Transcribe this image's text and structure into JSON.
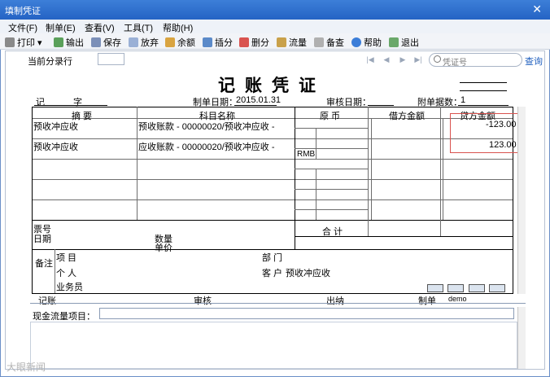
{
  "window": {
    "title": "填制凭证",
    "close_glyph": "✕"
  },
  "menu": [
    "文件(F)",
    "制单(E)",
    "查看(V)",
    "工具(T)",
    "帮助(H)"
  ],
  "toolbar": [
    {
      "label": "打印",
      "icon": "printer-icon"
    },
    {
      "label": "输出",
      "icon": "export-icon"
    },
    {
      "label": "保存",
      "icon": "save-icon"
    },
    {
      "label": "放弃",
      "icon": "discard-icon"
    },
    {
      "label": "余额",
      "icon": "balance-icon"
    },
    {
      "label": "插分",
      "icon": "insert-row-icon"
    },
    {
      "label": "删分",
      "icon": "delete-row-icon"
    },
    {
      "label": "流量",
      "icon": "cashflow-icon"
    },
    {
      "label": "备查",
      "icon": "memo-icon"
    },
    {
      "label": "帮助",
      "icon": "help-icon"
    },
    {
      "label": "退出",
      "icon": "exit-icon"
    }
  ],
  "entry_bar": {
    "current_entry_label": "当前分录行",
    "search_placeholder": "凭证号",
    "query_label": "查询"
  },
  "voucher": {
    "title": "记账凭证",
    "type_label": "记",
    "number_label": "字",
    "date_label": "制单日期：",
    "date_value": "2015.01.31",
    "review_date_label": "审核日期：",
    "attach_label": "附单据数：",
    "attach_value": "1",
    "headers": {
      "summary": "摘  要",
      "account": "科目名称",
      "currency": "原  币",
      "debit": "借方金额",
      "credit": "贷方金额"
    },
    "rows": [
      {
        "summary": "预收冲应收",
        "account": "预收账款 - 00000020/预收冲应收 -",
        "credit": "-123.00"
      },
      {
        "summary": "预收冲应收",
        "account": "应收账款 - 00000020/预收冲应收 -",
        "currency": "RMB",
        "credit": "123.00"
      }
    ],
    "footer": {
      "ticket_no": "票号",
      "date": "日期",
      "quantity": "数量",
      "unit_price": "单价",
      "total": "合  计",
      "remark": "备注",
      "project": "项  目",
      "department": "部  门",
      "person": "个  人",
      "customer": "客  户",
      "customer_value": "预收冲应收",
      "salesperson": "业务员"
    },
    "signatures": {
      "posting": "记账",
      "review": "审核",
      "cashier": "出纳",
      "maker": "制单",
      "maker_value": "demo"
    }
  },
  "cashflow": {
    "label": "现金流量项目："
  },
  "watermark": "大眼新闻"
}
